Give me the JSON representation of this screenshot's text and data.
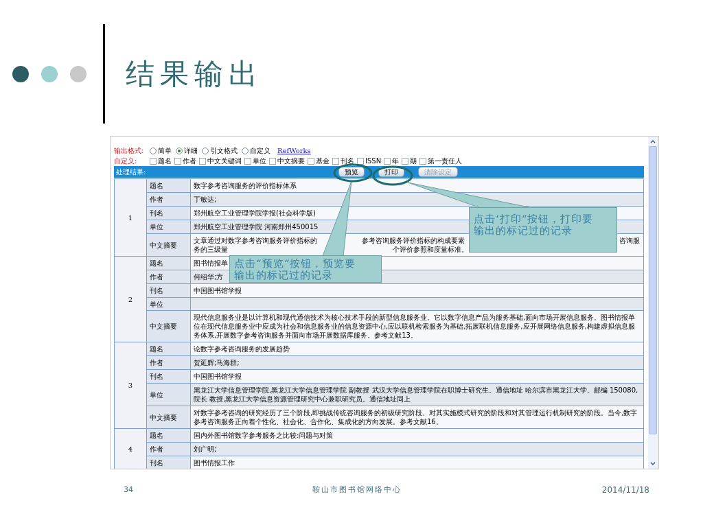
{
  "slide": {
    "title": "结果输出",
    "page_number": "34",
    "footer": "鞍山市图书馆网络中心",
    "date": "2014/11/18"
  },
  "form": {
    "format_label": "输出格式:",
    "formats": [
      {
        "label": "简单",
        "selected": false
      },
      {
        "label": "详细",
        "selected": true
      },
      {
        "label": "引文格式",
        "selected": false
      },
      {
        "label": "自定义",
        "selected": false
      }
    ],
    "link": "RefWorks",
    "custom_label": "自定义:",
    "fields": [
      {
        "label": "题名",
        "checked": false
      },
      {
        "label": "作者",
        "checked": false
      },
      {
        "label": "中文关键词",
        "checked": false
      },
      {
        "label": "单位",
        "checked": false
      },
      {
        "label": "中文摘要",
        "checked": false
      },
      {
        "label": "基金",
        "checked": false
      },
      {
        "label": "刊名",
        "checked": false
      },
      {
        "label": "ISSN",
        "checked": false
      },
      {
        "label": "年",
        "checked": false
      },
      {
        "label": "期",
        "checked": false
      },
      {
        "label": "第一责任人",
        "checked": false
      }
    ]
  },
  "results_bar": {
    "label": "处理结果:",
    "buttons": [
      {
        "label": "预览",
        "disabled": false
      },
      {
        "label": "打印",
        "disabled": false
      },
      {
        "label": "清除设定",
        "disabled": true
      }
    ]
  },
  "records": [
    {
      "number": "1",
      "fields": [
        {
          "label": "题名",
          "value": "数字参考咨询服务的评价指标体系"
        },
        {
          "label": "作者",
          "value": "丁敏达;"
        },
        {
          "label": "刊名",
          "value": "郑州航空工业管理学院学报(社会科学版)"
        },
        {
          "label": "单位",
          "value": "郑州航空工业管理学院 河南郑州450015"
        },
        {
          "label": "中文摘要",
          "kind": "fragments",
          "lines": [
            [
              "文章通过对数字参考咨询服务评价指标的",
              "参考咨询服务评价指标的构成要素",
              "咨询服"
            ],
            [
              "务的三级量",
              "个评价参照和度量标准。"
            ]
          ]
        }
      ]
    },
    {
      "number": "2",
      "fields": [
        {
          "label": "题名",
          "value": "图书情报单"
        },
        {
          "label": "作者",
          "value": "何绍华;方"
        },
        {
          "label": "刊名",
          "value": "中国图书馆学报"
        },
        {
          "label": "单位"
        },
        {
          "label": "中文摘要",
          "value": "现代信息服务业是以计算机和现代通信技术为核心技术手段的新型信息服务业。它以数字信息产品为服务基础,面向市场开展信息服务。图书情报单位在现代信息服务业中应成为社会和信息服务业的信息资源中心,应以联机检索服务为基础,拓展联机信息服务,应开展网络信息服务,构建虚拟信息服务体系,开展数字参考咨询服务并面向市场开展数据库服务。参考文献13。"
        }
      ]
    },
    {
      "number": "3",
      "fields": [
        {
          "label": "题名",
          "value": "论数字参考咨询服务的发展趋势"
        },
        {
          "label": "作者",
          "value": "贺延辉;马海群;"
        },
        {
          "label": "刊名",
          "value": "中国图书馆学报"
        },
        {
          "label": "单位",
          "value": "黑龙江大学信息管理学院,黑龙江大学信息管理学院 副教授 武汉大学信息管理学院在职博士研究生。通信地址 哈尔滨市黑龙江大学。邮编 150080,院长 教授,黑龙江大学信息资源管理研究中心兼职研究员。通信地址同上"
        },
        {
          "label": "中文摘要",
          "value": "对数字参考咨询的研究经历了三个阶段,即挑战传统咨询服务的初级研究阶段、对其实施模式研究的阶段和对其管理运行机制研究的阶段。当今,数字参考咨询服务正向着个性化、社会化、合作化、集成化的方向发展。参考文献16。"
        }
      ]
    },
    {
      "number": "4",
      "fields": [
        {
          "label": "题名",
          "value": "国内外图书馆数字参考服务之比较:问题与对策"
        },
        {
          "label": "作者",
          "value": "刘广明;"
        },
        {
          "label": "刊名",
          "value": "图书情报工作"
        }
      ]
    }
  ],
  "callouts": [
    {
      "lines": [
        "点击“预览“按钮，预览要",
        "输出的标记过的记录"
      ]
    },
    {
      "lines": [
        "点击‘打印“按钮，打印要",
        "输出的标记过的记录"
      ]
    }
  ]
}
